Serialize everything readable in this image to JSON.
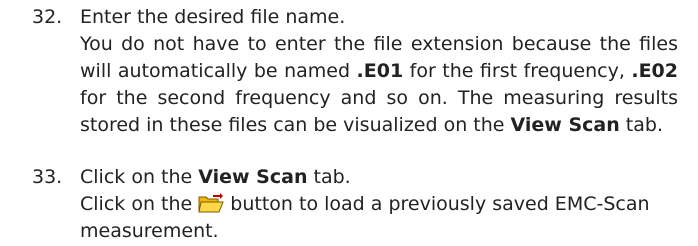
{
  "steps": [
    {
      "number": "32.",
      "heading": "Enter the desired file name.",
      "l1": "You do not have to enter the file extension because the files",
      "l2a": "will automatically be named ",
      "l2b": ".E01",
      "l2c": " for the first frequency, ",
      "l2d": ".E02",
      "l3a": "for the second frequency and so on. The measuring results",
      "l4a": "stored in these files can be visualized on the ",
      "l4b": "View Scan",
      "l4c": " tab."
    },
    {
      "number": "33.",
      "h_a": "Click on the ",
      "h_b": "View Scan",
      "h_c": " tab.",
      "l1a": "Click on the ",
      "l1b": " button to load a previously saved EMC-Scan",
      "l2": "measurement.",
      "icon": "open-folder-icon"
    }
  ]
}
